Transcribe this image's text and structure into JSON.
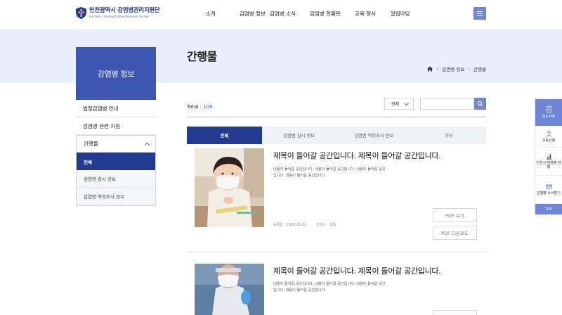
{
  "header": {
    "logo_ko": "인천광역시 감염병관리지원단",
    "logo_en": "Incheon Communicable Diseases Center",
    "nav": [
      "소개",
      "감염병 정보",
      "감염병 소식",
      "감염병 현황판",
      "교육·행사",
      "알림마당"
    ],
    "menu_icon": "hamburger-icon"
  },
  "page": {
    "title": "간행물",
    "breadcrumb": [
      "감염병 정보",
      "간행물"
    ]
  },
  "sidebar": {
    "heading": "감염병 정보",
    "items": [
      "법정감염병 안내",
      "감염병 관련 지침"
    ],
    "open_item": "간행물",
    "sub_items": [
      "전체",
      "감염병 감시 연보",
      "감염병 역학조사 연보"
    ]
  },
  "list": {
    "total_label": "Total : ",
    "total_count": "100",
    "filter_value": "전체",
    "search_placeholder": "",
    "tabs": [
      "전체",
      "감염병 감시 연보",
      "감염병 역학조사 연보",
      "기타"
    ],
    "items": [
      {
        "title": "제목이 들어갈 공간입니다. 제목이 들어갈 공간입니다.",
        "desc": "내용이 들어갈 공간입니다. 내용이 들어갈 공간입니다. 내용이 들어갈 공간입니다. 내용이 들어갈 공간입니다.",
        "date": "등록일 : 2023.01.01",
        "views": "조회수 : 101",
        "btn_view": "PDF 보기",
        "btn_download": "PDF 다운로드"
      },
      {
        "title": "제목이 들어갈 공간입니다. 제목이 들어갈 공간입니다.",
        "desc": "내용이 들어갈 공간입니다. 내용이 들어갈 공간입니다. 내용이 들어갈 공간입니다. 내용이 들어갈 공간입니다."
      }
    ]
  },
  "quickbar": {
    "head": "보도자료",
    "items": [
      "교육신청",
      "인천시 감염병 현황",
      "감염병 소식받기"
    ],
    "top": "TOP"
  },
  "colors": {
    "primary_dark": "#233b8f",
    "primary": "#3d56b3",
    "accent": "#6f86d8",
    "banner_bg": "#e9eefb"
  }
}
